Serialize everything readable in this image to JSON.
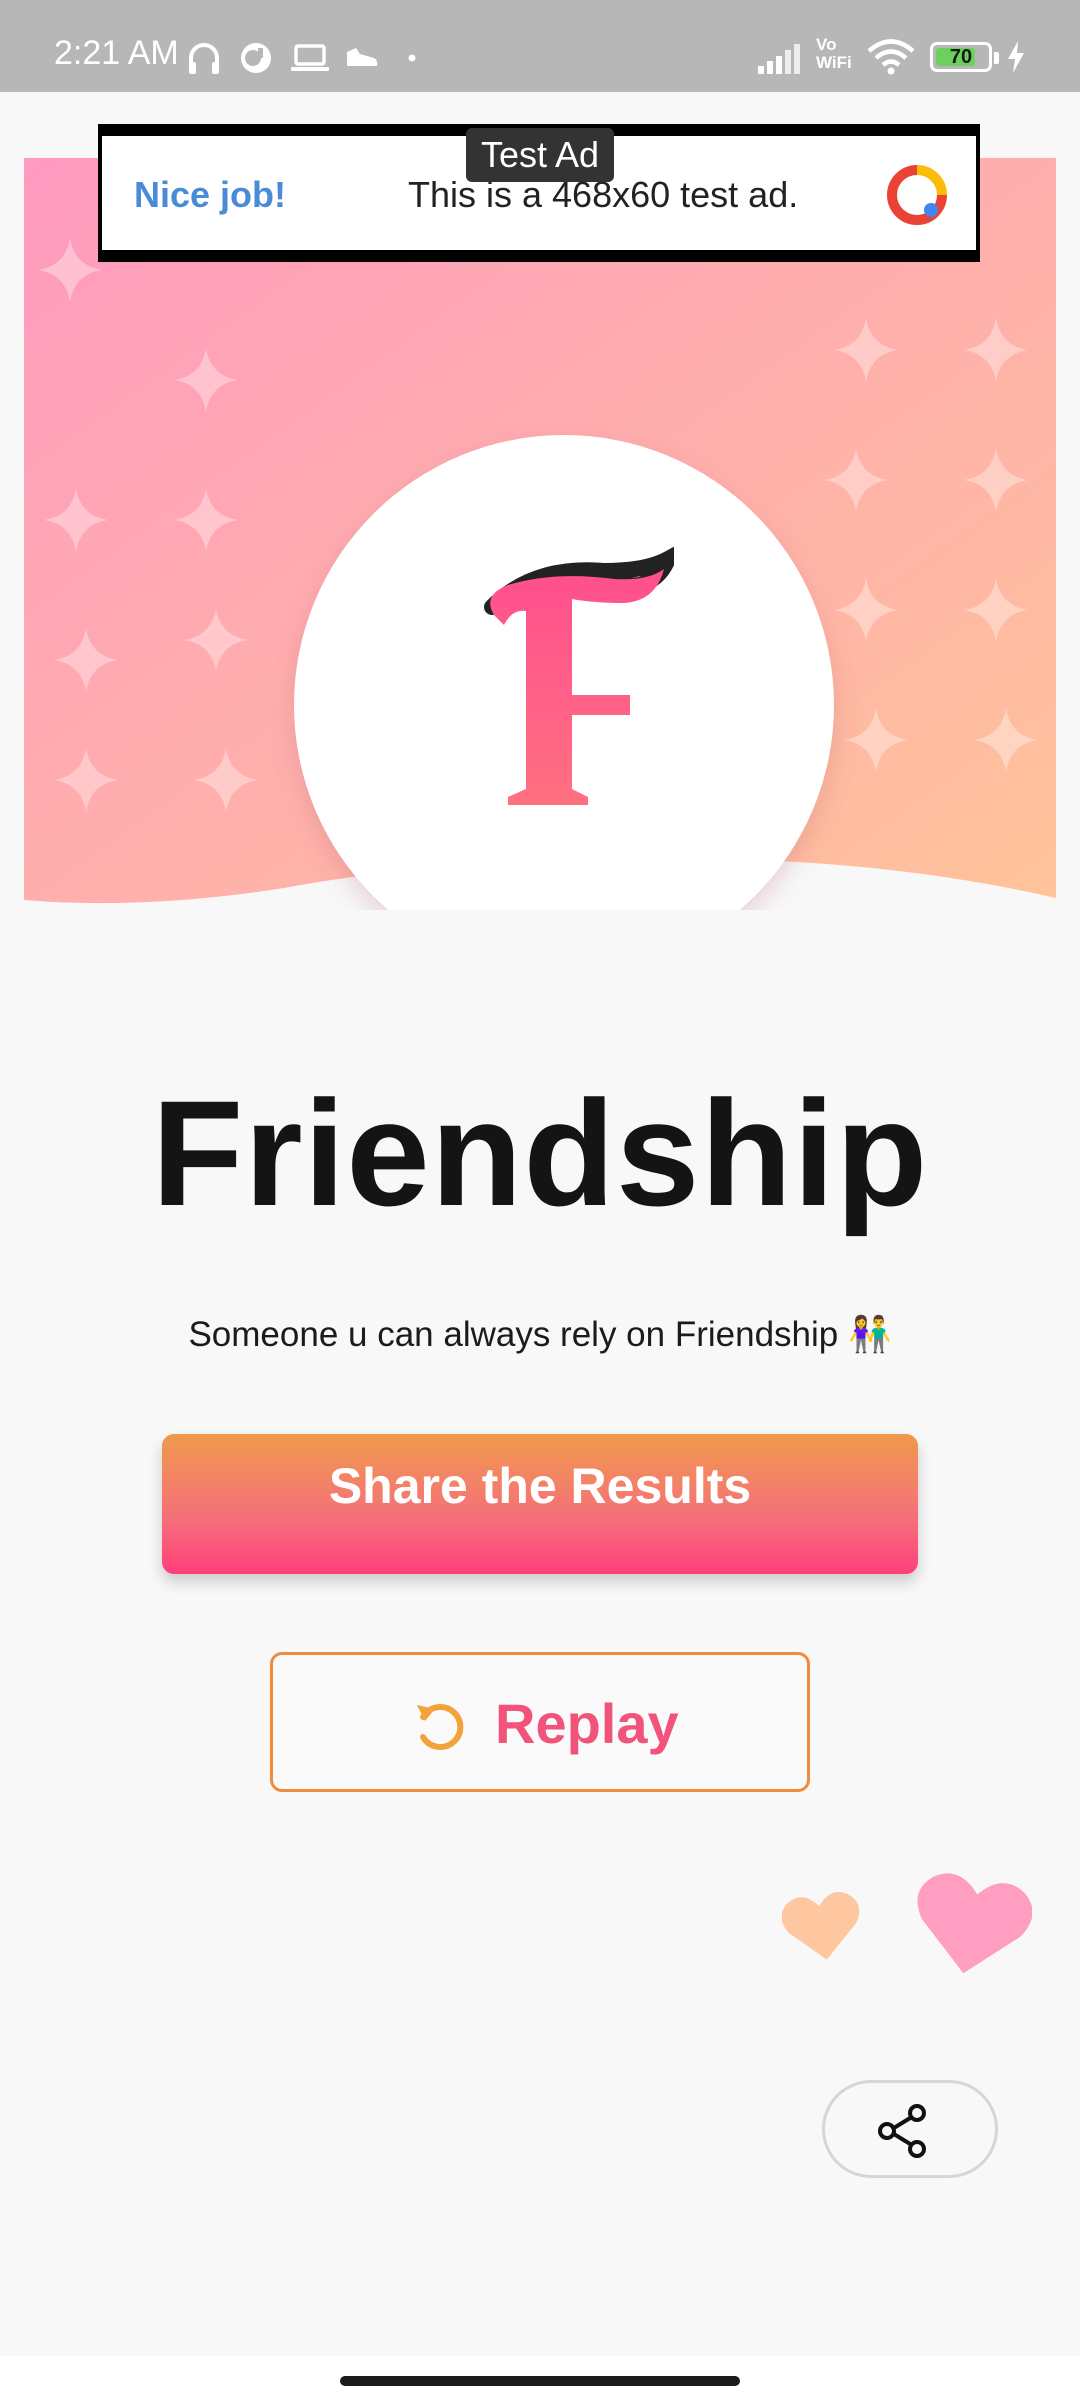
{
  "status_bar": {
    "time": "2:21 AM",
    "vo_wifi_line1": "Vo",
    "vo_wifi_line2": "WiFi",
    "battery_level": "70",
    "icons": [
      "headphones-icon",
      "app-notification-icon",
      "laptop-icon",
      "shoe-icon",
      "dot-icon",
      "signal-icon",
      "wifi-icon",
      "battery-icon",
      "charging-icon"
    ]
  },
  "ad": {
    "label": "Test Ad",
    "headline": "Nice job!",
    "body": "This is a 468x60 test ad.",
    "logo_icon": "ad-choices-logo-icon"
  },
  "header": {
    "avatar_letter": "F",
    "gradient_start": "#ff9ac0",
    "gradient_end": "#ffc39a"
  },
  "result": {
    "title": "Friendship",
    "description": "Someone u can always rely on Friendship 👫"
  },
  "actions": {
    "share_results_label": "Share the Results",
    "replay_label": "Replay",
    "share_icon": "share-icon"
  },
  "colors": {
    "accent_pink": "#f1537a",
    "accent_orange": "#f08b3c",
    "ad_link_blue": "#4a8bd8"
  }
}
